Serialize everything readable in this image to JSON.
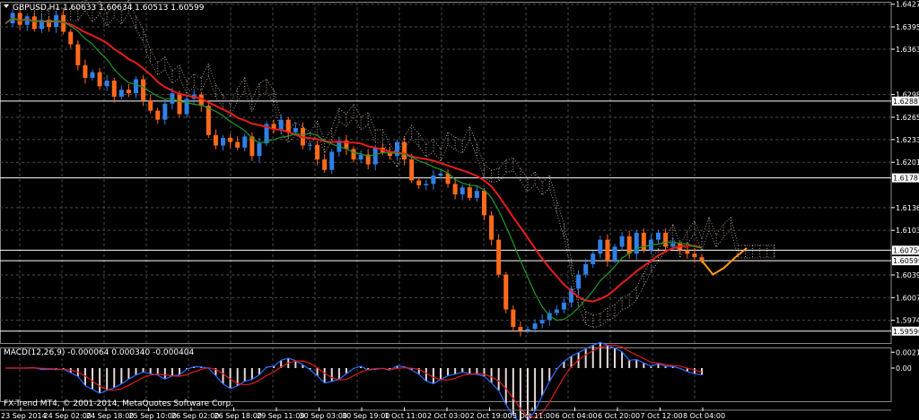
{
  "header": {
    "symbol_line": "GBPUSD,H1  1.60633 1.60634 1.60513 1.60599"
  },
  "footer": {
    "copyright": "FX-Trend MT4, © 2001-2014, MetaQuotes Software Corp."
  },
  "chart_data": [
    {
      "type": "candlestick",
      "symbol": "GBPUSD",
      "timeframe": "H1",
      "ohlc_current": {
        "open": 1.60633,
        "high": 1.60634,
        "low": 1.60513,
        "close": 1.60599
      },
      "ylim": [
        1.5942,
        1.6431
      ],
      "y_ticks": [
        "1.64275",
        "1.63950",
        "1.63630",
        "1.62980",
        "1.62655",
        "1.62335",
        "1.62010",
        "1.61360",
        "1.61035",
        "1.60395",
        "1.60070",
        "1.59745"
      ],
      "horizontal_levels": [
        {
          "value": "1.62887",
          "color": "#ffffff"
        },
        {
          "value": "1.61787",
          "color": "#ffffff"
        },
        {
          "value": "1.60750",
          "color": "#ffffff"
        },
        {
          "value": "1.60599",
          "color": "#ffffff"
        },
        {
          "value": "1.59590",
          "color": "#ffffff"
        }
      ],
      "x_ticks": [
        "23 Sep 2014",
        "24 Sep 02:00",
        "24 Sep 18:00",
        "25 Sep 10:00",
        "26 Sep 02:00",
        "26 Sep 18:00",
        "29 Sep 11:00",
        "30 Sep 03:00",
        "30 Sep 19:00",
        "1 Oct 11:00",
        "2 Oct 03:00",
        "2 Oct 19:00",
        "3 Oct 11:00",
        "6 Oct 04:00",
        "6 Oct 20:00",
        "7 Oct 12:00",
        "8 Oct 04:00"
      ],
      "close_path": [
        1.64,
        1.6415,
        1.6398,
        1.641,
        1.6392,
        1.6405,
        1.6395,
        1.6412,
        1.6388,
        1.637,
        1.634,
        1.6322,
        1.633,
        1.631,
        1.6318,
        1.6295,
        1.6305,
        1.63,
        1.632,
        1.629,
        1.6275,
        1.6262,
        1.6285,
        1.63,
        1.627,
        1.6292,
        1.6298,
        1.6282,
        1.624,
        1.6225,
        1.6236,
        1.623,
        1.6222,
        1.6238,
        1.621,
        1.6228,
        1.6256,
        1.6248,
        1.6262,
        1.6244,
        1.625,
        1.6225,
        1.6226,
        1.6205,
        1.619,
        1.6216,
        1.6232,
        1.622,
        1.6205,
        1.6212,
        1.6198,
        1.6222,
        1.6215,
        1.621,
        1.623,
        1.6205,
        1.6175,
        1.6168,
        1.617,
        1.6182,
        1.6185,
        1.617,
        1.6155,
        1.6165,
        1.615,
        1.616,
        1.6125,
        1.609,
        1.604,
        1.599,
        1.5965,
        1.596,
        1.5962,
        1.597,
        1.5975,
        1.5985,
        1.599,
        1.6,
        1.602,
        1.604,
        1.6055,
        1.607,
        1.609,
        1.606,
        1.608,
        1.6095,
        1.607,
        1.61,
        1.6075,
        1.609,
        1.61,
        1.608,
        1.6085,
        1.6075,
        1.607,
        1.6065,
        1.606
      ],
      "forecast_path": [
        1.606,
        1.604,
        1.605,
        1.6065,
        1.6078
      ],
      "indicator": {
        "name": "MACD(12,26,9)",
        "values_text": "MACD(12,26,9) -0.000064 0.000340 -0.000404",
        "y_ticks": [
          "0.002161",
          "0.00"
        ],
        "ylim": [
          -0.0045,
          0.0028
        ]
      },
      "colors": {
        "bull": "#2f7fe6",
        "bear": "#ff6a1a",
        "ma_slow": "#e81c1c",
        "ma_fast": "#1f9a2a",
        "cloud": "#e8d2c4",
        "forecast": "#ff9d1a",
        "grid": "#4a4a4a",
        "macd_line": "#2a6bff",
        "signal_line": "#e01b1b"
      }
    }
  ]
}
